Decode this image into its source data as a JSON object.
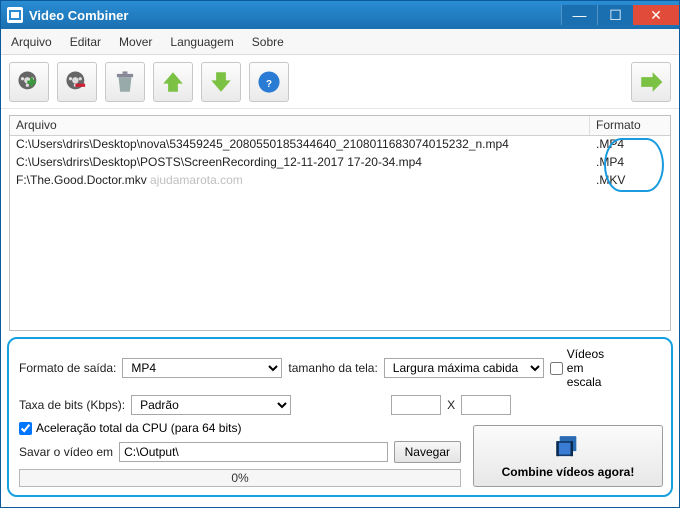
{
  "window": {
    "title": "Video Combiner"
  },
  "menu": {
    "arquivo": "Arquivo",
    "editar": "Editar",
    "mover": "Mover",
    "languagem": "Languagem",
    "sobre": "Sobre"
  },
  "filelist": {
    "header_file": "Arquivo",
    "header_format": "Formato",
    "rows": [
      {
        "path": "C:\\Users\\drirs\\Desktop\\nova\\53459245_2080550185344640_2108011683074015232_n.mp4",
        "fmt": ".MP4"
      },
      {
        "path": "C:\\Users\\drirs\\Desktop\\POSTS\\ScreenRecording_12-11-2017 17-20-34.mp4",
        "fmt": ".MP4"
      },
      {
        "path": "F:\\The.Good.Doctor.mkv",
        "fmt": ".MKV"
      }
    ],
    "watermark": "ajudamarota.com"
  },
  "panel": {
    "output_format_label": "Formato de saída:",
    "output_format_value": "MP4",
    "screen_size_label": "tamanho da tela:",
    "screen_size_value": "Largura máxima cabida",
    "scale_videos_label": "Vídeos em escala",
    "bitrate_label": "Taxa de bits (Kbps):",
    "bitrate_value": "Padrão",
    "dim_x": "X",
    "cpu_accel_label": "Aceleração total da CPU (para 64 bits)",
    "save_label": "Savar o vídeo em",
    "save_path": "C:\\Output\\",
    "browse": "Navegar",
    "progress": "0%",
    "combine": "Combine vídeos agora!"
  }
}
